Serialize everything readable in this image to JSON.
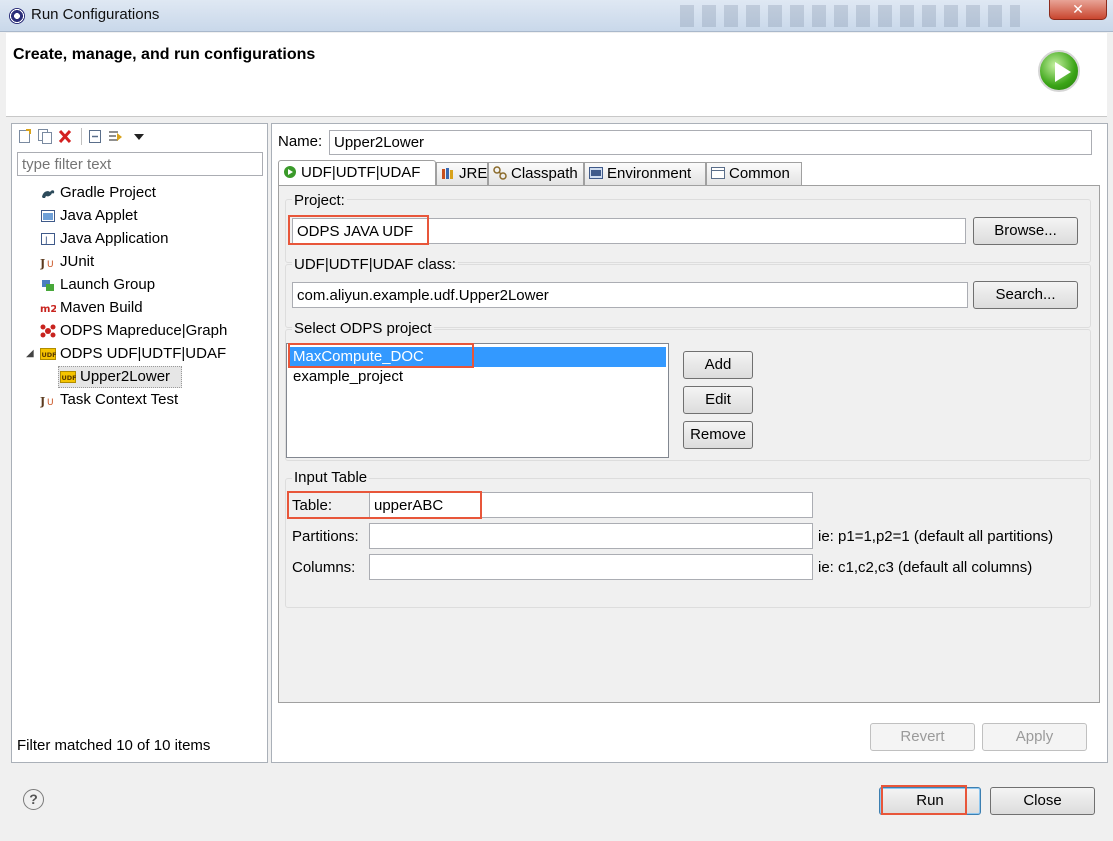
{
  "window": {
    "title": "Run Configurations",
    "close_label": "✕"
  },
  "header": {
    "title": "Create, manage, and run configurations"
  },
  "left": {
    "filter_placeholder": "type filter text",
    "tree": [
      {
        "label": "Gradle Project",
        "icon": "gradle-icon"
      },
      {
        "label": "Java Applet",
        "icon": "java-applet-icon"
      },
      {
        "label": "Java Application",
        "icon": "java-application-icon"
      },
      {
        "label": "JUnit",
        "icon": "junit-icon"
      },
      {
        "label": "Launch Group",
        "icon": "launch-group-icon"
      },
      {
        "label": "Maven Build",
        "icon": "maven-icon"
      },
      {
        "label": "ODPS Mapreduce|Graph",
        "icon": "odps-mapreduce-icon"
      },
      {
        "label": "ODPS UDF|UDTF|UDAF",
        "icon": "udf-icon",
        "expanded": true
      },
      {
        "label": "Upper2Lower",
        "icon": "udf-icon",
        "selected": true
      },
      {
        "label": "Task Context Test",
        "icon": "junit-icon"
      }
    ],
    "filter_status": "Filter matched 10 of 10 items"
  },
  "right": {
    "name_label": "Name:",
    "name_value": "Upper2Lower",
    "tabs": [
      {
        "label": "UDF|UDTF|UDAF",
        "active": true
      },
      {
        "label": "JRE"
      },
      {
        "label": "Classpath"
      },
      {
        "label": "Environment"
      },
      {
        "label": "Common"
      }
    ],
    "project": {
      "label": "Project:",
      "value": "ODPS JAVA UDF",
      "browse": "Browse..."
    },
    "udf_class": {
      "label": "UDF|UDTF|UDAF class:",
      "value": "com.aliyun.example.udf.Upper2Lower",
      "search": "Search..."
    },
    "odps_project": {
      "label": "Select ODPS project",
      "items": [
        "MaxCompute_DOC",
        "example_project"
      ],
      "selected_index": 0,
      "add": "Add",
      "edit": "Edit",
      "remove": "Remove"
    },
    "input_table": {
      "label": "Input Table",
      "table_label": "Table:",
      "table_value": "upperABC",
      "partitions_label": "Partitions:",
      "partitions_value": "",
      "partitions_hint": "ie: p1=1,p2=1 (default all partitions)",
      "columns_label": "Columns:",
      "columns_value": "",
      "columns_hint": "ie: c1,c2,c3 (default all columns)"
    },
    "revert": "Revert",
    "apply": "Apply"
  },
  "footer": {
    "help": "?",
    "run": "Run",
    "close": "Close"
  }
}
